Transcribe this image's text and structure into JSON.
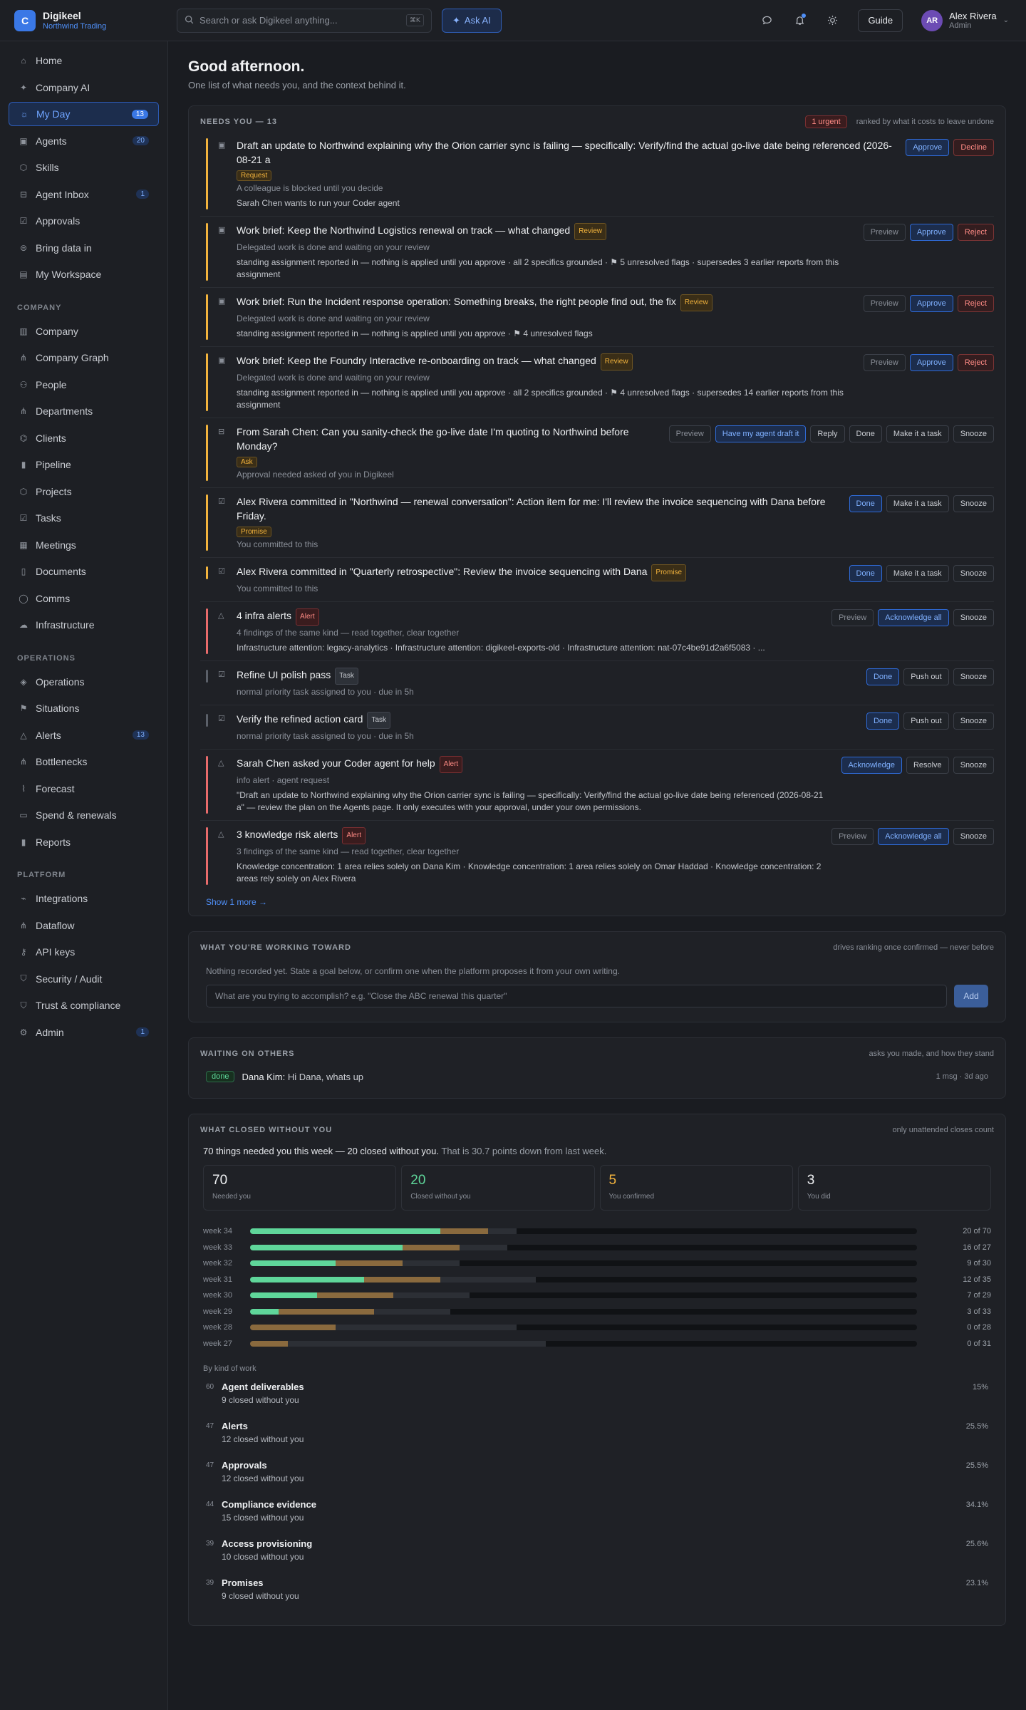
{
  "app": {
    "name": "Digikeel",
    "org": "Northwind Trading",
    "logo": "C"
  },
  "search": {
    "placeholder": "Search or ask Digikeel anything...",
    "shortcut": "⌘K"
  },
  "ask_ai": "Ask AI",
  "guide": "Guide",
  "user": {
    "initials": "AR",
    "name": "Alex Rivera",
    "role": "Admin"
  },
  "sidebar": {
    "main": [
      {
        "label": "Home",
        "icon": "home-icon",
        "glyph": "⌂"
      },
      {
        "label": "Company AI",
        "icon": "sparkle-icon",
        "glyph": "✦"
      },
      {
        "label": "My Day",
        "icon": "sun-icon",
        "glyph": "☼",
        "badge": "13",
        "active": true
      },
      {
        "label": "Agents",
        "icon": "robot-icon",
        "glyph": "▣",
        "badge": "20"
      },
      {
        "label": "Skills",
        "icon": "cube-icon",
        "glyph": "⬡"
      },
      {
        "label": "Agent Inbox",
        "icon": "inbox-icon",
        "glyph": "⊟",
        "badge": "1"
      },
      {
        "label": "Approvals",
        "icon": "check-square-icon",
        "glyph": "☑"
      },
      {
        "label": "Bring data in",
        "icon": "database-icon",
        "glyph": "⊜"
      },
      {
        "label": "My Workspace",
        "icon": "layers-icon",
        "glyph": "▤"
      }
    ],
    "company_label": "COMPANY",
    "company": [
      {
        "label": "Company",
        "icon": "building-icon",
        "glyph": "▥"
      },
      {
        "label": "Company Graph",
        "icon": "graph-icon",
        "glyph": "⋔"
      },
      {
        "label": "People",
        "icon": "people-icon",
        "glyph": "⚇"
      },
      {
        "label": "Departments",
        "icon": "org-icon",
        "glyph": "⋔"
      },
      {
        "label": "Clients",
        "icon": "handshake-icon",
        "glyph": "⌬"
      },
      {
        "label": "Pipeline",
        "icon": "bar-chart-icon",
        "glyph": "▮"
      },
      {
        "label": "Projects",
        "icon": "box-icon",
        "glyph": "⬡"
      },
      {
        "label": "Tasks",
        "icon": "check-square-icon",
        "glyph": "☑"
      },
      {
        "label": "Meetings",
        "icon": "calendar-icon",
        "glyph": "▦"
      },
      {
        "label": "Documents",
        "icon": "document-icon",
        "glyph": "▯"
      },
      {
        "label": "Comms",
        "icon": "chat-icon",
        "glyph": "◯"
      },
      {
        "label": "Infrastructure",
        "icon": "cloud-icon",
        "glyph": "☁"
      }
    ],
    "operations_label": "OPERATIONS",
    "operations": [
      {
        "label": "Operations",
        "icon": "layers-icon",
        "glyph": "◈"
      },
      {
        "label": "Situations",
        "icon": "flag-icon",
        "glyph": "⚑"
      },
      {
        "label": "Alerts",
        "icon": "warning-icon",
        "glyph": "△",
        "badge": "13"
      },
      {
        "label": "Bottlenecks",
        "icon": "funnel-icon",
        "glyph": "⋔"
      },
      {
        "label": "Forecast",
        "icon": "trend-icon",
        "glyph": "⌇"
      },
      {
        "label": "Spend & renewals",
        "icon": "wallet-icon",
        "glyph": "▭"
      },
      {
        "label": "Reports",
        "icon": "bar-chart-icon",
        "glyph": "▮"
      }
    ],
    "platform_label": "PLATFORM",
    "platform": [
      {
        "label": "Integrations",
        "icon": "plug-icon",
        "glyph": "⌁"
      },
      {
        "label": "Dataflow",
        "icon": "flow-icon",
        "glyph": "⋔"
      },
      {
        "label": "API keys",
        "icon": "key-icon",
        "glyph": "⚷"
      },
      {
        "label": "Security / Audit",
        "icon": "shield-icon",
        "glyph": "⛉"
      },
      {
        "label": "Trust & compliance",
        "icon": "shield-check-icon",
        "glyph": "⛉"
      },
      {
        "label": "Admin",
        "icon": "gear-icon",
        "glyph": "⚙",
        "badge": "1"
      }
    ]
  },
  "header": {
    "greeting": "Good afternoon.",
    "subtitle": "One list of what needs you, and the context behind it."
  },
  "needs": {
    "title": "NEEDS YOU — 13",
    "urgent": "1 urgent",
    "note": "ranked by what it costs to leave undone",
    "show_more": "Show 1 more →",
    "items": [
      {
        "bar": "amber",
        "icon": "robot-icon",
        "glyph": "▣",
        "title": "Draft an update to Northwind explaining why the Orion carrier sync is failing — specifically: Verify/find the actual go-live date being referenced (2026-08-21 a",
        "tag": "Request",
        "tagclass": "request",
        "tag_below": true,
        "sub": "A colleague is blocked until you decide",
        "desc": "Sarah Chen wants to run your Coder agent",
        "actions": [
          {
            "label": "Approve",
            "kind": "primary"
          },
          {
            "label": "Decline",
            "kind": "danger"
          }
        ]
      },
      {
        "bar": "amber",
        "icon": "robot-icon",
        "glyph": "▣",
        "title": "Work brief: Keep the Northwind Logistics renewal on track — what changed",
        "tag": "Review",
        "tagclass": "review",
        "sub": "Delegated work is done and waiting on your review",
        "desc": "standing assignment reported in — nothing is applied until you approve · all 2 specifics grounded · ⚑ 5 unresolved flags · supersedes 3 earlier reports from this assignment",
        "actions": [
          {
            "label": "Preview",
            "kind": "muted"
          },
          {
            "label": "Approve",
            "kind": "primary"
          },
          {
            "label": "Reject",
            "kind": "danger"
          }
        ]
      },
      {
        "bar": "amber",
        "icon": "robot-icon",
        "glyph": "▣",
        "title": "Work brief: Run the Incident response operation: Something breaks, the right people find out, the fix",
        "tag": "Review",
        "tagclass": "review",
        "sub": "Delegated work is done and waiting on your review",
        "desc": "standing assignment reported in — nothing is applied until you approve · ⚑ 4 unresolved flags",
        "actions": [
          {
            "label": "Preview",
            "kind": "muted"
          },
          {
            "label": "Approve",
            "kind": "primary"
          },
          {
            "label": "Reject",
            "kind": "danger"
          }
        ]
      },
      {
        "bar": "amber",
        "icon": "robot-icon",
        "glyph": "▣",
        "title": "Work brief: Keep the Foundry Interactive re-onboarding on track — what changed",
        "tag": "Review",
        "tagclass": "review",
        "sub": "Delegated work is done and waiting on your review",
        "desc": "standing assignment reported in — nothing is applied until you approve · all 2 specifics grounded · ⚑ 4 unresolved flags · supersedes 14 earlier reports from this assignment",
        "actions": [
          {
            "label": "Preview",
            "kind": "muted"
          },
          {
            "label": "Approve",
            "kind": "primary"
          },
          {
            "label": "Reject",
            "kind": "danger"
          }
        ]
      },
      {
        "bar": "amber",
        "icon": "inbox-icon",
        "glyph": "⊟",
        "title": "From Sarah Chen: Can you sanity-check the go-live date I'm quoting to Northwind before Monday?",
        "tag": "Ask",
        "tagclass": "ask",
        "tag_below": true,
        "sub": "Approval needed asked of you in Digikeel",
        "desc": "",
        "actions": [
          {
            "label": "Preview",
            "kind": "muted"
          },
          {
            "label": "Have my agent draft it",
            "kind": "primary"
          },
          {
            "label": "Reply",
            "kind": ""
          },
          {
            "label": "Done",
            "kind": ""
          },
          {
            "label": "Make it a task",
            "kind": ""
          },
          {
            "label": "Snooze",
            "kind": ""
          }
        ]
      },
      {
        "bar": "amber",
        "icon": "check-square-icon",
        "glyph": "☑",
        "title": "Alex Rivera committed in \"Northwind — renewal conversation\": Action item for me: I'll review the invoice sequencing with Dana before Friday.",
        "tag": "Promise",
        "tagclass": "promise",
        "tag_below": true,
        "sub": "You committed to this",
        "desc": "",
        "actions": [
          {
            "label": "Done",
            "kind": "primary"
          },
          {
            "label": "Make it a task",
            "kind": ""
          },
          {
            "label": "Snooze",
            "kind": ""
          }
        ]
      },
      {
        "bar": "amber",
        "icon": "check-square-icon",
        "glyph": "☑",
        "title": "Alex Rivera committed in \"Quarterly retrospective\": Review the invoice sequencing with Dana",
        "tag": "Promise",
        "tagclass": "promise",
        "sub": "You committed to this",
        "desc": "",
        "actions": [
          {
            "label": "Done",
            "kind": "primary"
          },
          {
            "label": "Make it a task",
            "kind": ""
          },
          {
            "label": "Snooze",
            "kind": ""
          }
        ]
      },
      {
        "bar": "red",
        "icon": "warning-icon",
        "glyph": "△",
        "title": "4 infra alerts",
        "tag": "Alert",
        "tagclass": "alert",
        "sub": "4 findings of the same kind — read together, clear together",
        "desc": "Infrastructure attention: legacy-analytics · Infrastructure attention: digikeel-exports-old · Infrastructure attention: nat-07c4be91d2a6f5083 · ...",
        "actions": [
          {
            "label": "Preview",
            "kind": "muted"
          },
          {
            "label": "Acknowledge all",
            "kind": "primary"
          },
          {
            "label": "Snooze",
            "kind": ""
          }
        ]
      },
      {
        "bar": "gray",
        "icon": "check-square-icon",
        "glyph": "☑",
        "title": "Refine UI polish pass",
        "tag": "Task",
        "tagclass": "task",
        "sub": "normal priority task assigned to you   · due in 5h",
        "desc": "",
        "actions": [
          {
            "label": "Done",
            "kind": "primary"
          },
          {
            "label": "Push out",
            "kind": ""
          },
          {
            "label": "Snooze",
            "kind": ""
          }
        ]
      },
      {
        "bar": "gray",
        "icon": "check-square-icon",
        "glyph": "☑",
        "title": "Verify the refined action card",
        "tag": "Task",
        "tagclass": "task",
        "sub": "normal priority task assigned to you   · due in 5h",
        "desc": "",
        "actions": [
          {
            "label": "Done",
            "kind": "primary"
          },
          {
            "label": "Push out",
            "kind": ""
          },
          {
            "label": "Snooze",
            "kind": ""
          }
        ]
      },
      {
        "bar": "red",
        "icon": "warning-icon",
        "glyph": "△",
        "title": "Sarah Chen asked your Coder agent for help",
        "tag": "Alert",
        "tagclass": "alert",
        "sub": "info alert · agent request",
        "desc": "\"Draft an update to Northwind explaining why the Orion carrier sync is failing — specifically: Verify/find the actual go-live date being referenced (2026-08-21 a\" — review the plan on the Agents page. It only executes with your approval, under your own permissions.",
        "actions": [
          {
            "label": "Acknowledge",
            "kind": "primary"
          },
          {
            "label": "Resolve",
            "kind": ""
          },
          {
            "label": "Snooze",
            "kind": ""
          }
        ]
      },
      {
        "bar": "red",
        "icon": "warning-icon",
        "glyph": "△",
        "title": "3 knowledge risk alerts",
        "tag": "Alert",
        "tagclass": "alert",
        "sub": "3 findings of the same kind — read together, clear together",
        "desc": "Knowledge concentration: 1 area relies solely on Dana Kim · Knowledge concentration: 1 area relies solely on Omar Haddad · Knowledge concentration: 2 areas rely solely on Alex Rivera",
        "actions": [
          {
            "label": "Preview",
            "kind": "muted"
          },
          {
            "label": "Acknowledge all",
            "kind": "primary"
          },
          {
            "label": "Snooze",
            "kind": ""
          }
        ]
      }
    ]
  },
  "goals": {
    "title": "WHAT YOU'RE WORKING TOWARD",
    "note": "drives ranking once confirmed — never before",
    "empty": "Nothing recorded yet. State a goal below, or confirm one when the platform proposes it from your own writing.",
    "placeholder": "What are you trying to accomplish? e.g. \"Close the ABC renewal this quarter\"",
    "add": "Add"
  },
  "waiting": {
    "title": "WAITING ON OTHERS",
    "note": "asks you made, and how they stand",
    "status": "done",
    "who": "Dana Kim:",
    "text": "Hi Dana, whats up",
    "meta": "1 msg · 3d ago"
  },
  "closed": {
    "title": "WHAT CLOSED WITHOUT YOU",
    "note": "only unattended closes count",
    "summary_strong": "70 things needed you this week — 20 closed without you.",
    "summary_rest": "That is 30.7 points down from last week.",
    "stats": [
      {
        "value": "70",
        "label": "Needed you",
        "tone": ""
      },
      {
        "value": "20",
        "label": "Closed without you",
        "tone": "green"
      },
      {
        "value": "5",
        "label": "You confirmed",
        "tone": "amber"
      },
      {
        "value": "3",
        "label": "You did",
        "tone": ""
      }
    ],
    "weeks": [
      {
        "label": "week 34",
        "closed": 20,
        "confirmed": 5,
        "did": 3,
        "total": 70,
        "text": "20 of 70"
      },
      {
        "label": "week 33",
        "closed": 16,
        "confirmed": 6,
        "did": 5,
        "total": 27,
        "text": "16 of 27"
      },
      {
        "label": "week 32",
        "closed": 9,
        "confirmed": 7,
        "did": 6,
        "total": 30,
        "text": "9 of 30"
      },
      {
        "label": "week 31",
        "closed": 12,
        "confirmed": 8,
        "did": 10,
        "total": 35,
        "text": "12 of 35"
      },
      {
        "label": "week 30",
        "closed": 7,
        "confirmed": 8,
        "did": 8,
        "total": 29,
        "text": "7 of 29"
      },
      {
        "label": "week 29",
        "closed": 3,
        "confirmed": 10,
        "did": 8,
        "total": 33,
        "text": "3 of 33"
      },
      {
        "label": "week 28",
        "closed": 0,
        "confirmed": 9,
        "did": 19,
        "total": 28,
        "text": "0 of 28"
      },
      {
        "label": "week 27",
        "closed": 0,
        "confirmed": 4,
        "did": 27,
        "total": 31,
        "text": "0 of 31"
      }
    ],
    "kind_label": "By kind of work",
    "kinds": [
      {
        "n": "60",
        "name": "Agent deliverables",
        "sub": "9 closed without you",
        "pct": "15%"
      },
      {
        "n": "47",
        "name": "Alerts",
        "sub": "12 closed without you",
        "pct": "25.5%"
      },
      {
        "n": "47",
        "name": "Approvals",
        "sub": "12 closed without you",
        "pct": "25.5%"
      },
      {
        "n": "44",
        "name": "Compliance evidence",
        "sub": "15 closed without you",
        "pct": "34.1%"
      },
      {
        "n": "39",
        "name": "Access provisioning",
        "sub": "10 closed without you",
        "pct": "25.6%"
      },
      {
        "n": "39",
        "name": "Promises",
        "sub": "9 closed without you",
        "pct": "23.1%"
      }
    ]
  }
}
